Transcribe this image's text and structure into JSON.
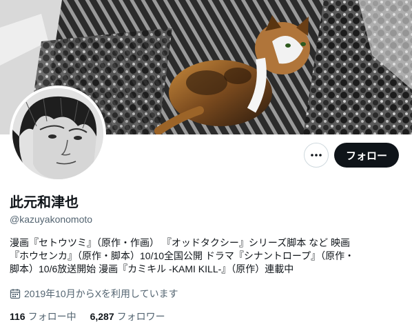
{
  "profile": {
    "display_name": "此元和津也",
    "handle": "@kazuyakonomoto",
    "bio_lines": [
      "漫画『セトウツミ』（原作・作画） 『オッドタクシー』シリーズ脚本 など 映画",
      "『ホウセンカ』（原作・脚本）10/10全国公開 ドラマ『シナントロープ』（原作・",
      "脚本）10/6放送開始 漫画『カミキル -KAMI KILL-』（原作）連載中"
    ],
    "joined": "2019年10月からXを利用しています",
    "following_count": "116",
    "following_label": "フォロー中",
    "followers_count": "6,287",
    "followers_label": "フォロワー"
  },
  "actions": {
    "follow_label": "フォロー"
  },
  "icons": {
    "more": "more-horizontal-icon",
    "calendar": "calendar-icon"
  },
  "colors": {
    "text_primary": "#0f1419",
    "text_secondary": "#536471",
    "button_dark": "#0f1419",
    "border": "#cfd9de"
  }
}
